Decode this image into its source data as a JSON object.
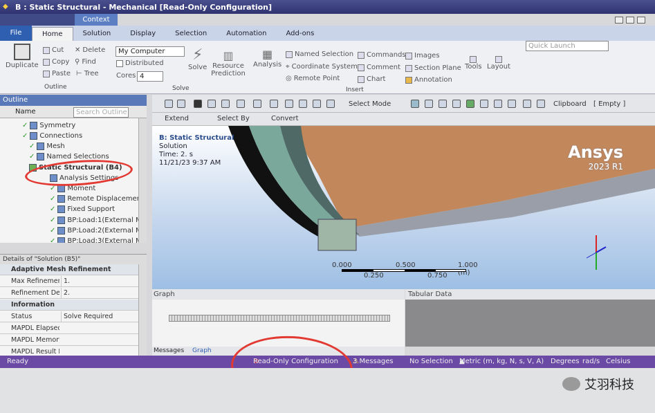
{
  "window": {
    "title": "B : Static Structural - Mechanical [Read-Only Configuration]",
    "context_label": "Context"
  },
  "ribbon_tabs": [
    "File",
    "Home",
    "Solution",
    "Display",
    "Selection",
    "Automation",
    "Add-ons"
  ],
  "quick_launch": {
    "placeholder": "Quick Launch"
  },
  "ribbon": {
    "outline_group": {
      "duplicate": "Duplicate",
      "cut": "Cut",
      "copy": "Copy",
      "paste": "Paste",
      "delete": "Delete",
      "find": "Find",
      "tree": "Tree",
      "label": "Outline"
    },
    "solve_group": {
      "computer": "My Computer",
      "distributed": "Distributed",
      "cores_label": "Cores",
      "cores_value": "4",
      "solve": "Solve",
      "resource_prediction": "Resource Prediction",
      "label": "Solve"
    },
    "insert_group": {
      "analysis": "Analysis",
      "named_selection": "Named Selection",
      "coordinate_system": "Coordinate System",
      "remote_point": "Remote Point",
      "commands": "Commands",
      "comment": "Comment",
      "chart": "Chart",
      "images": "Images",
      "section_plane": "Section Plane",
      "annotation": "Annotation",
      "label": "Insert"
    },
    "tools": "Tools",
    "layout": "Layout"
  },
  "outline": {
    "title": "Outline",
    "name_col": "Name",
    "search_placeholder": "Search Outline",
    "items": [
      {
        "label": "Symmetry"
      },
      {
        "label": "Connections"
      },
      {
        "label": "Mesh"
      },
      {
        "label": "Named Selections"
      },
      {
        "label": "Static Structural (B4)"
      },
      {
        "label": "Analysis Settings"
      },
      {
        "label": "Moment"
      },
      {
        "label": "Remote Displacement"
      },
      {
        "label": "Fixed Support"
      },
      {
        "label": "BP:Load:1(External M"
      },
      {
        "label": "BP:Load:2(External M"
      },
      {
        "label": "BP:Load:3(External M"
      }
    ]
  },
  "details": {
    "title": "Details of \"Solution (B5)\"",
    "sections": [
      {
        "name": "Adaptive Mesh Refinement",
        "rows": [
          {
            "key": "Max Refinement Loops",
            "value": "1."
          },
          {
            "key": "Refinement Depth",
            "value": "2."
          }
        ]
      },
      {
        "name": "Information",
        "rows": [
          {
            "key": "Status",
            "value": "Solve Required"
          },
          {
            "key": "MAPDL Elapsed Time",
            "value": ""
          },
          {
            "key": "MAPDL Memory Used",
            "value": ""
          },
          {
            "key": "MAPDL Result File",
            "value": ""
          }
        ]
      }
    ]
  },
  "toolbar": {
    "select": "Select",
    "mode": "Mode",
    "clipboard": "Clipboard",
    "empty": "[ Empty ]",
    "extend": "Extend",
    "select_by": "Select By",
    "convert": "Convert"
  },
  "viewport": {
    "title": "B: Static Structural",
    "subtitle": "Solution",
    "time": "Time: 2. s",
    "date": "11/21/23 9:37 AM",
    "brand": "Ansys",
    "release": "2023 R1",
    "scale_top": [
      "0.000",
      "0.500",
      "1.000 (m)"
    ],
    "scale_bottom": [
      "0.250",
      "0.750"
    ]
  },
  "graph": {
    "title": "Graph"
  },
  "tabular": {
    "title": "Tabular Data"
  },
  "message_tabs": [
    "Messages",
    "Graph"
  ],
  "status": {
    "ready": "Ready",
    "readonly": "Read-Only Configuration",
    "messages": "3 Messages",
    "selection": "No Selection",
    "units": "Metric (m, kg, N, s, V, A)",
    "degrees": "Degrees",
    "rads": "rad/s",
    "celsius": "Celsius"
  },
  "watermark": "艾羽科技",
  "colors": {
    "titlebar": "#2f3370",
    "statusbar": "#6b4aa6",
    "annotation": "#e23a32",
    "accent": "#2f5fb0"
  }
}
